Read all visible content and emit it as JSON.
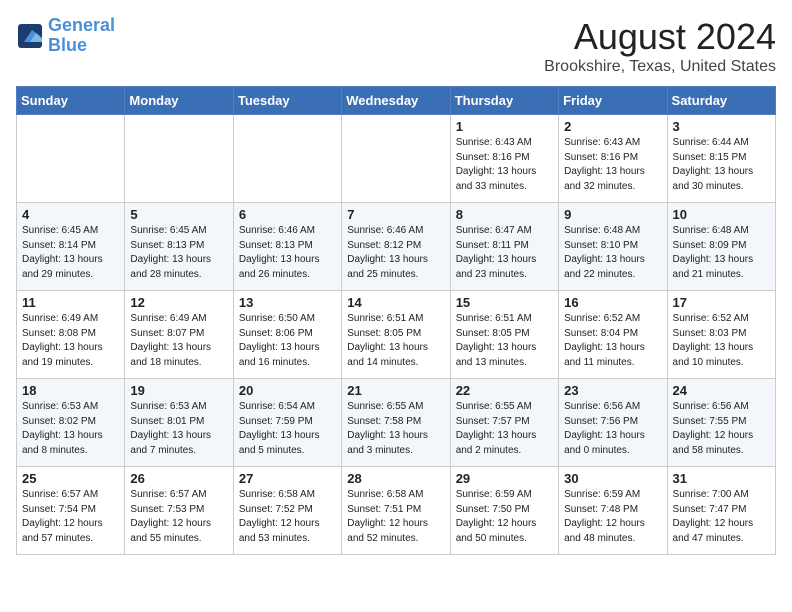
{
  "header": {
    "logo_line1": "General",
    "logo_line2": "Blue",
    "month": "August 2024",
    "location": "Brookshire, Texas, United States"
  },
  "days_of_week": [
    "Sunday",
    "Monday",
    "Tuesday",
    "Wednesday",
    "Thursday",
    "Friday",
    "Saturday"
  ],
  "weeks": [
    [
      {
        "day": "",
        "text": ""
      },
      {
        "day": "",
        "text": ""
      },
      {
        "day": "",
        "text": ""
      },
      {
        "day": "",
        "text": ""
      },
      {
        "day": "1",
        "text": "Sunrise: 6:43 AM\nSunset: 8:16 PM\nDaylight: 13 hours\nand 33 minutes."
      },
      {
        "day": "2",
        "text": "Sunrise: 6:43 AM\nSunset: 8:16 PM\nDaylight: 13 hours\nand 32 minutes."
      },
      {
        "day": "3",
        "text": "Sunrise: 6:44 AM\nSunset: 8:15 PM\nDaylight: 13 hours\nand 30 minutes."
      }
    ],
    [
      {
        "day": "4",
        "text": "Sunrise: 6:45 AM\nSunset: 8:14 PM\nDaylight: 13 hours\nand 29 minutes."
      },
      {
        "day": "5",
        "text": "Sunrise: 6:45 AM\nSunset: 8:13 PM\nDaylight: 13 hours\nand 28 minutes."
      },
      {
        "day": "6",
        "text": "Sunrise: 6:46 AM\nSunset: 8:13 PM\nDaylight: 13 hours\nand 26 minutes."
      },
      {
        "day": "7",
        "text": "Sunrise: 6:46 AM\nSunset: 8:12 PM\nDaylight: 13 hours\nand 25 minutes."
      },
      {
        "day": "8",
        "text": "Sunrise: 6:47 AM\nSunset: 8:11 PM\nDaylight: 13 hours\nand 23 minutes."
      },
      {
        "day": "9",
        "text": "Sunrise: 6:48 AM\nSunset: 8:10 PM\nDaylight: 13 hours\nand 22 minutes."
      },
      {
        "day": "10",
        "text": "Sunrise: 6:48 AM\nSunset: 8:09 PM\nDaylight: 13 hours\nand 21 minutes."
      }
    ],
    [
      {
        "day": "11",
        "text": "Sunrise: 6:49 AM\nSunset: 8:08 PM\nDaylight: 13 hours\nand 19 minutes."
      },
      {
        "day": "12",
        "text": "Sunrise: 6:49 AM\nSunset: 8:07 PM\nDaylight: 13 hours\nand 18 minutes."
      },
      {
        "day": "13",
        "text": "Sunrise: 6:50 AM\nSunset: 8:06 PM\nDaylight: 13 hours\nand 16 minutes."
      },
      {
        "day": "14",
        "text": "Sunrise: 6:51 AM\nSunset: 8:05 PM\nDaylight: 13 hours\nand 14 minutes."
      },
      {
        "day": "15",
        "text": "Sunrise: 6:51 AM\nSunset: 8:05 PM\nDaylight: 13 hours\nand 13 minutes."
      },
      {
        "day": "16",
        "text": "Sunrise: 6:52 AM\nSunset: 8:04 PM\nDaylight: 13 hours\nand 11 minutes."
      },
      {
        "day": "17",
        "text": "Sunrise: 6:52 AM\nSunset: 8:03 PM\nDaylight: 13 hours\nand 10 minutes."
      }
    ],
    [
      {
        "day": "18",
        "text": "Sunrise: 6:53 AM\nSunset: 8:02 PM\nDaylight: 13 hours\nand 8 minutes."
      },
      {
        "day": "19",
        "text": "Sunrise: 6:53 AM\nSunset: 8:01 PM\nDaylight: 13 hours\nand 7 minutes."
      },
      {
        "day": "20",
        "text": "Sunrise: 6:54 AM\nSunset: 7:59 PM\nDaylight: 13 hours\nand 5 minutes."
      },
      {
        "day": "21",
        "text": "Sunrise: 6:55 AM\nSunset: 7:58 PM\nDaylight: 13 hours\nand 3 minutes."
      },
      {
        "day": "22",
        "text": "Sunrise: 6:55 AM\nSunset: 7:57 PM\nDaylight: 13 hours\nand 2 minutes."
      },
      {
        "day": "23",
        "text": "Sunrise: 6:56 AM\nSunset: 7:56 PM\nDaylight: 13 hours\nand 0 minutes."
      },
      {
        "day": "24",
        "text": "Sunrise: 6:56 AM\nSunset: 7:55 PM\nDaylight: 12 hours\nand 58 minutes."
      }
    ],
    [
      {
        "day": "25",
        "text": "Sunrise: 6:57 AM\nSunset: 7:54 PM\nDaylight: 12 hours\nand 57 minutes."
      },
      {
        "day": "26",
        "text": "Sunrise: 6:57 AM\nSunset: 7:53 PM\nDaylight: 12 hours\nand 55 minutes."
      },
      {
        "day": "27",
        "text": "Sunrise: 6:58 AM\nSunset: 7:52 PM\nDaylight: 12 hours\nand 53 minutes."
      },
      {
        "day": "28",
        "text": "Sunrise: 6:58 AM\nSunset: 7:51 PM\nDaylight: 12 hours\nand 52 minutes."
      },
      {
        "day": "29",
        "text": "Sunrise: 6:59 AM\nSunset: 7:50 PM\nDaylight: 12 hours\nand 50 minutes."
      },
      {
        "day": "30",
        "text": "Sunrise: 6:59 AM\nSunset: 7:48 PM\nDaylight: 12 hours\nand 48 minutes."
      },
      {
        "day": "31",
        "text": "Sunrise: 7:00 AM\nSunset: 7:47 PM\nDaylight: 12 hours\nand 47 minutes."
      }
    ]
  ]
}
